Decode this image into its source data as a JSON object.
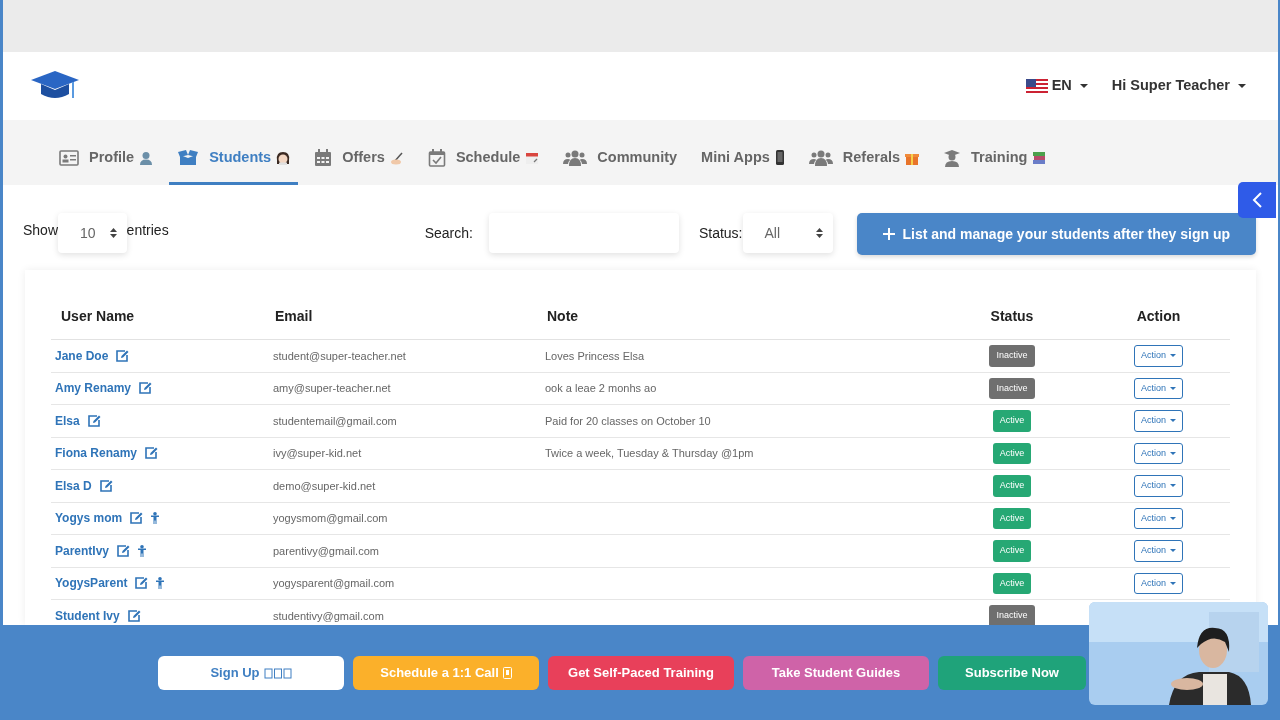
{
  "header": {
    "language": "EN",
    "user_menu": "Hi Super Teacher"
  },
  "tabs": [
    {
      "label": "Profile",
      "kind": "profile",
      "selected": false
    },
    {
      "label": "Students",
      "kind": "students",
      "selected": true
    },
    {
      "label": "Offers",
      "kind": "offers",
      "selected": false
    },
    {
      "label": "Schedule",
      "kind": "schedule",
      "selected": false
    },
    {
      "label": "Community",
      "kind": "community",
      "selected": false
    },
    {
      "label": "Mini Apps",
      "kind": "miniapps",
      "selected": false
    },
    {
      "label": "Referals",
      "kind": "referals",
      "selected": false
    },
    {
      "label": "Training",
      "kind": "training",
      "selected": false
    }
  ],
  "controls": {
    "show_label": "Show",
    "entries_value": "10",
    "entries_label": "entries",
    "search_label": "Search:",
    "status_label": "Status:",
    "status_value": "All",
    "add_button": "List and manage your students after they sign up"
  },
  "table": {
    "columns": [
      "User Name",
      "Email",
      "Note",
      "Status",
      "Action"
    ],
    "rows": [
      {
        "name": "Jane Doe",
        "parent": false,
        "email": "student@super-teacher.net",
        "note": "Loves Princess Elsa",
        "status": "Inactive",
        "active": false,
        "action": "Action"
      },
      {
        "name": "Amy Renamy",
        "parent": false,
        "email": "amy@super-teacher.net",
        "note": "ook a leae 2 monhs ao",
        "status": "Inactive",
        "active": false,
        "action": "Action"
      },
      {
        "name": "Elsa",
        "parent": false,
        "email": "studentemail@gmail.com",
        "note": "Paid for 20 classes on October 10",
        "status": "Active",
        "active": true,
        "action": "Action"
      },
      {
        "name": "Fiona Renamy",
        "parent": false,
        "email": "ivy@super-kid.net",
        "note": "Twice a week, Tuesday & Thursday @1pm",
        "status": "Active",
        "active": true,
        "action": "Action"
      },
      {
        "name": "Elsa D",
        "parent": false,
        "email": "demo@super-kid.net",
        "status": "Active",
        "active": true,
        "action": "Action"
      },
      {
        "name": "Yogys mom",
        "parent": true,
        "email": "yogysmom@gmail.com",
        "status": "Active",
        "active": true,
        "action": "Action"
      },
      {
        "name": "ParentIvy",
        "parent": true,
        "email": "parentivy@gmail.com",
        "status": "Active",
        "active": true,
        "action": "Action"
      },
      {
        "name": "YogysParent",
        "parent": true,
        "email": "yogysparent@gmail.com",
        "status": "Active",
        "active": true,
        "action": "Action"
      },
      {
        "name": "Student Ivy",
        "parent": false,
        "email": "studentivy@gmail.com",
        "status": "Inactive",
        "active": false
      }
    ]
  },
  "footer_buttons": [
    {
      "label": "Sign Up",
      "kind": "signup",
      "color": "#ffffff"
    },
    {
      "label": "Schedule a 1:1 Call",
      "kind": "call",
      "color": "#fbb02a"
    },
    {
      "label": "Get Self-Paced Training",
      "kind": "plain",
      "color": "#e8405a"
    },
    {
      "label": "Take Student Guides",
      "kind": "plain",
      "color": "#cf63a8"
    },
    {
      "label": "Subscribe Now",
      "kind": "plain",
      "color": "#1fa37a"
    }
  ]
}
